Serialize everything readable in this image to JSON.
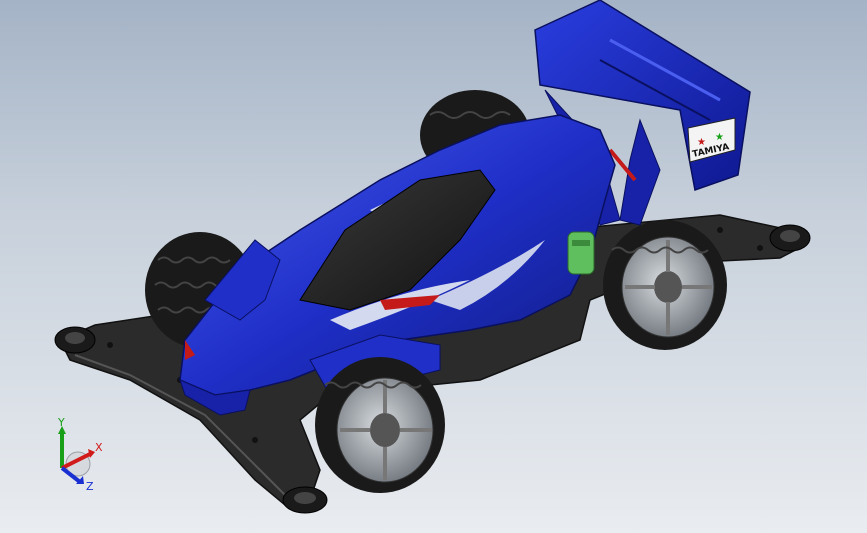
{
  "viewport": {
    "background_top": "#a4b3c6",
    "background_bottom": "#e9ecf0"
  },
  "model": {
    "body_color": "#1f2fc8",
    "body_highlight": "#4a5ef0",
    "chassis_color": "#2b2b2b",
    "tire_color": "#1a1a1a",
    "rim_color": "#9aa0a8",
    "accent_red": "#c41a1a",
    "motor_green": "#5fbf5f",
    "wing_logo_text": "TAMIYA"
  },
  "triad": {
    "x_label": "X",
    "y_label": "Y",
    "z_label": "Z",
    "x_color": "#d11a1a",
    "y_color": "#18a018",
    "z_color": "#1a2fd1"
  }
}
